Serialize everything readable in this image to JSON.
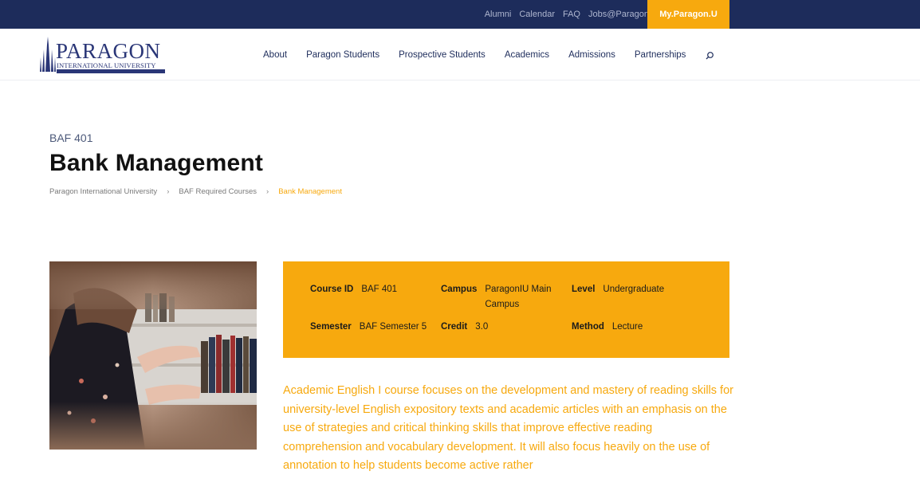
{
  "topbar": {
    "links": [
      "Alumni",
      "Calendar",
      "FAQ",
      "Jobs@Paragon.U"
    ],
    "portal_button": "My.Paragon.U"
  },
  "logo": {
    "name": "PARAGON",
    "subtitle": "INTERNATIONAL UNIVERSITY"
  },
  "nav": {
    "items": [
      "About",
      "Paragon Students",
      "Prospective Students",
      "Academics",
      "Admissions",
      "Partnerships"
    ]
  },
  "page": {
    "course_code": "BAF 401",
    "title": "Bank Management"
  },
  "breadcrumb": {
    "items": [
      "Paragon International University",
      "BAF Required Courses",
      "Bank Management"
    ],
    "separator": "›"
  },
  "course_info": {
    "course_id": {
      "label": "Course ID",
      "value": "BAF 401"
    },
    "campus": {
      "label": "Campus",
      "value": "ParagonIU Main Campus"
    },
    "level": {
      "label": "Level",
      "value": "Undergraduate"
    },
    "semester": {
      "label": "Semester",
      "value": "BAF Semester 5"
    },
    "credit": {
      "label": "Credit",
      "value": "3.0"
    },
    "method": {
      "label": "Method",
      "value": "Lecture"
    }
  },
  "description": "Academic English I course focuses on the development and mastery of reading skills for university-level English expository texts and academic articles with an emphasis on the use of strategies and critical thinking skills that improve effective reading comprehension and vocabulary development.  It will also focus heavily on the use of annotation to help students become active rather",
  "colors": {
    "navy": "#1d2c5b",
    "accent": "#f7a90e"
  },
  "icons": {
    "search": "search-icon"
  }
}
